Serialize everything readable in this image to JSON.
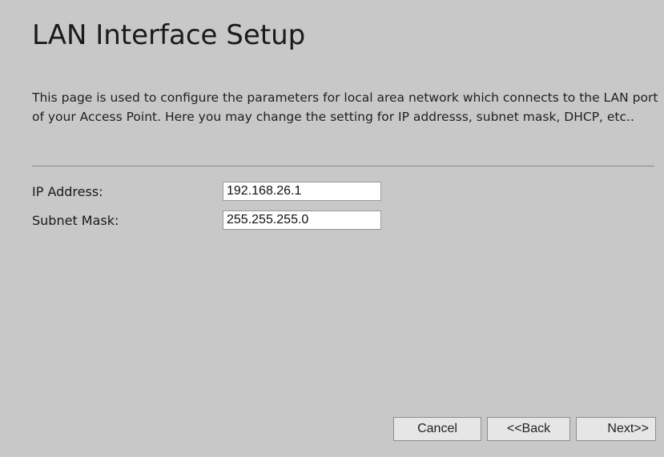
{
  "header": {
    "title": "LAN Interface Setup"
  },
  "intro": {
    "text": "This page is used to configure the parameters for local area network which connects to the LAN port of your Access Point. Here you may change the setting for IP addresss, subnet mask, DHCP, etc.."
  },
  "fields": {
    "ip_address": {
      "label": "IP Address:",
      "value": "192.168.26.1"
    },
    "subnet_mask": {
      "label": "Subnet Mask:",
      "value": "255.255.255.0"
    }
  },
  "buttons": {
    "cancel": "Cancel",
    "back": "<<Back",
    "next": "Next>>"
  },
  "colors": {
    "background": "#c8c8c8",
    "input_background": "#ffffff",
    "button_background": "#e6e6e6"
  }
}
